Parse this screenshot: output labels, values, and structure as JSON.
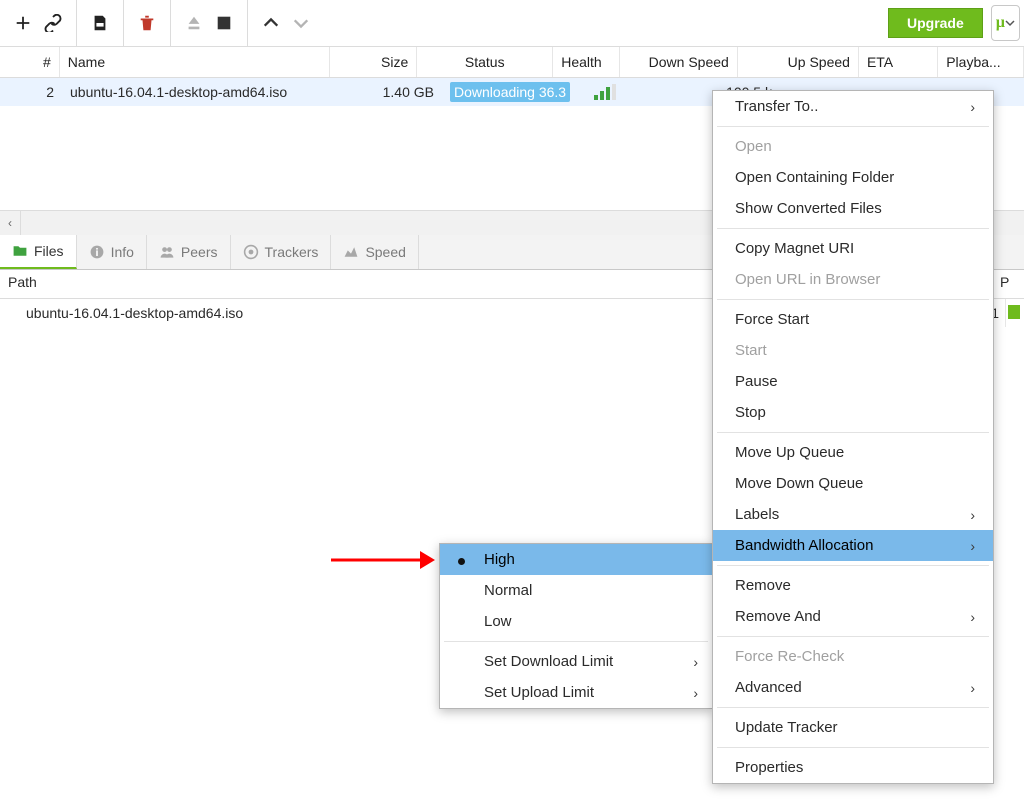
{
  "toolbar": {
    "upgrade": "Upgrade"
  },
  "columns": {
    "num": "#",
    "name": "Name",
    "size": "Size",
    "status": "Status",
    "health": "Health",
    "down": "Down Speed",
    "up": "Up Speed",
    "eta": "ETA",
    "playback": "Playba..."
  },
  "torrent": {
    "num": "2",
    "name": "ubuntu-16.04.1-desktop-amd64.iso",
    "size": "1.40 GB",
    "status": "Downloading 36.3",
    "down": "100.5 k"
  },
  "tabs": {
    "files": "Files",
    "info": "Info",
    "peers": "Peers",
    "trackers": "Trackers",
    "speed": "Speed"
  },
  "details": {
    "pathHeader": "Path",
    "pCol": "P",
    "filePath": "ubuntu-16.04.1-desktop-amd64.iso",
    "fileNum": "1"
  },
  "context": {
    "transferTo": "Transfer To..",
    "open": "Open",
    "openContaining": "Open Containing Folder",
    "showConverted": "Show Converted Files",
    "copyMagnet": "Copy Magnet URI",
    "openUrl": "Open URL in Browser",
    "forceStart": "Force Start",
    "start": "Start",
    "pause": "Pause",
    "stop": "Stop",
    "moveUp": "Move Up Queue",
    "moveDown": "Move Down Queue",
    "labels": "Labels",
    "bandwidth": "Bandwidth Allocation",
    "remove": "Remove",
    "removeAnd": "Remove And",
    "forceRecheck": "Force Re-Check",
    "advanced": "Advanced",
    "updateTracker": "Update Tracker",
    "properties": "Properties"
  },
  "submenu": {
    "high": "High",
    "normal": "Normal",
    "low": "Low",
    "setDownload": "Set Download Limit",
    "setUpload": "Set Upload Limit"
  }
}
